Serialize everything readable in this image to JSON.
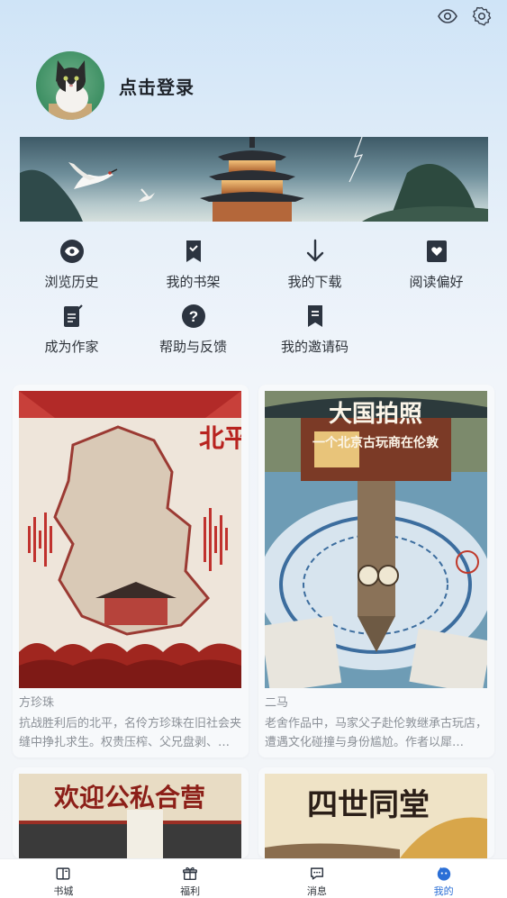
{
  "profile": {
    "login_text": "点击登录"
  },
  "top_icons": [
    "eye-icon",
    "settings-gear-icon"
  ],
  "menu": {
    "items": [
      {
        "label": "浏览历史",
        "icon": "eye-icon"
      },
      {
        "label": "我的书架",
        "icon": "bookmark-icon"
      },
      {
        "label": "我的下载",
        "icon": "download-arrow-icon"
      },
      {
        "label": "阅读偏好",
        "icon": "heart-bookmark-icon"
      },
      {
        "label": "成为作家",
        "icon": "write-document-icon"
      },
      {
        "label": "帮助与反馈",
        "icon": "help-question-icon"
      },
      {
        "label": "我的邀请码",
        "icon": "invite-code-icon"
      }
    ]
  },
  "books": [
    {
      "cover_title": "北平少女",
      "author": "方珍珠",
      "description": "抗战胜利后的北平，名伶方珍珠在旧社会夹缝中挣扎求生。权贵压榨、父兄盘剥、…"
    },
    {
      "cover_title": "大国拍照",
      "cover_subtitle": "一个北京古玩商在伦敦",
      "author": "二马",
      "description": "老舍作品中，马家父子赴伦敦继承古玩店，遭遇文化碰撞与身份尴尬。作者以犀…"
    },
    {
      "cover_title": "欢迎公私合营"
    },
    {
      "cover_title": "四世同堂"
    }
  ],
  "bottom_nav": {
    "items": [
      {
        "label": "书城",
        "icon": "book-city-icon"
      },
      {
        "label": "福利",
        "icon": "gift-icon"
      },
      {
        "label": "消息",
        "icon": "message-icon"
      },
      {
        "label": "我的",
        "icon": "profile-face-icon"
      }
    ],
    "active": "我的"
  },
  "colors": {
    "accent": "#2b6fd6",
    "icon_dark": "#2c3440"
  }
}
